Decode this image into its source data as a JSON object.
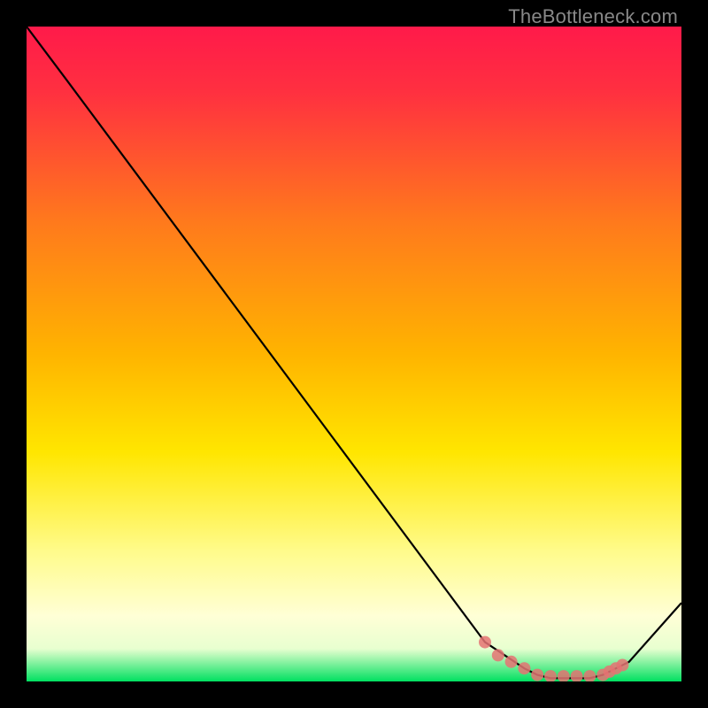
{
  "watermark": "TheBottleneck.com",
  "chart_data": {
    "type": "line",
    "x": [
      0,
      6,
      70,
      76,
      78,
      80,
      82,
      84,
      86,
      88,
      90,
      92,
      100
    ],
    "series": [
      {
        "name": "curve",
        "values": [
          100,
          92,
          6,
          2,
          1,
          0.5,
          0.5,
          0.5,
          0.5,
          1,
          2,
          3,
          12
        ]
      }
    ],
    "markers_x": [
      70,
      72,
      74,
      76,
      78,
      80,
      82,
      84,
      86,
      88,
      89,
      90,
      91
    ],
    "markers_y": [
      6,
      4,
      3,
      2,
      1,
      0.8,
      0.8,
      0.8,
      0.8,
      1,
      1.5,
      2,
      2.5
    ],
    "green_band_y": [
      0,
      2
    ],
    "ylim": [
      0,
      100
    ],
    "xlim": [
      0,
      100
    ],
    "title": "",
    "xlabel": "",
    "ylabel": ""
  },
  "colors": {
    "gradient_top": "#ff1744",
    "gradient_mid1": "#ff9100",
    "gradient_mid2": "#ffea00",
    "gradient_pale": "#ffffcc",
    "gradient_green": "#00e676",
    "line": "#000000",
    "marker": "#e57373",
    "bg": "#000000"
  }
}
